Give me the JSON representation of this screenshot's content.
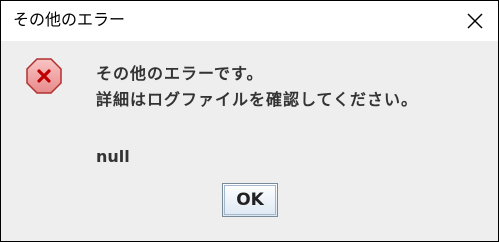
{
  "window": {
    "title": "その他のエラー"
  },
  "dialog": {
    "message_line1": "その他のエラーです。",
    "message_line2": "詳細はログファイルを確認してください。",
    "detail": "null",
    "ok_label": "OK"
  },
  "icons": {
    "close": "close-icon",
    "error": "error-icon"
  },
  "colors": {
    "error_icon_fill": "#f4a8a8",
    "error_icon_stroke": "#b03030",
    "error_x": "#c00000"
  }
}
